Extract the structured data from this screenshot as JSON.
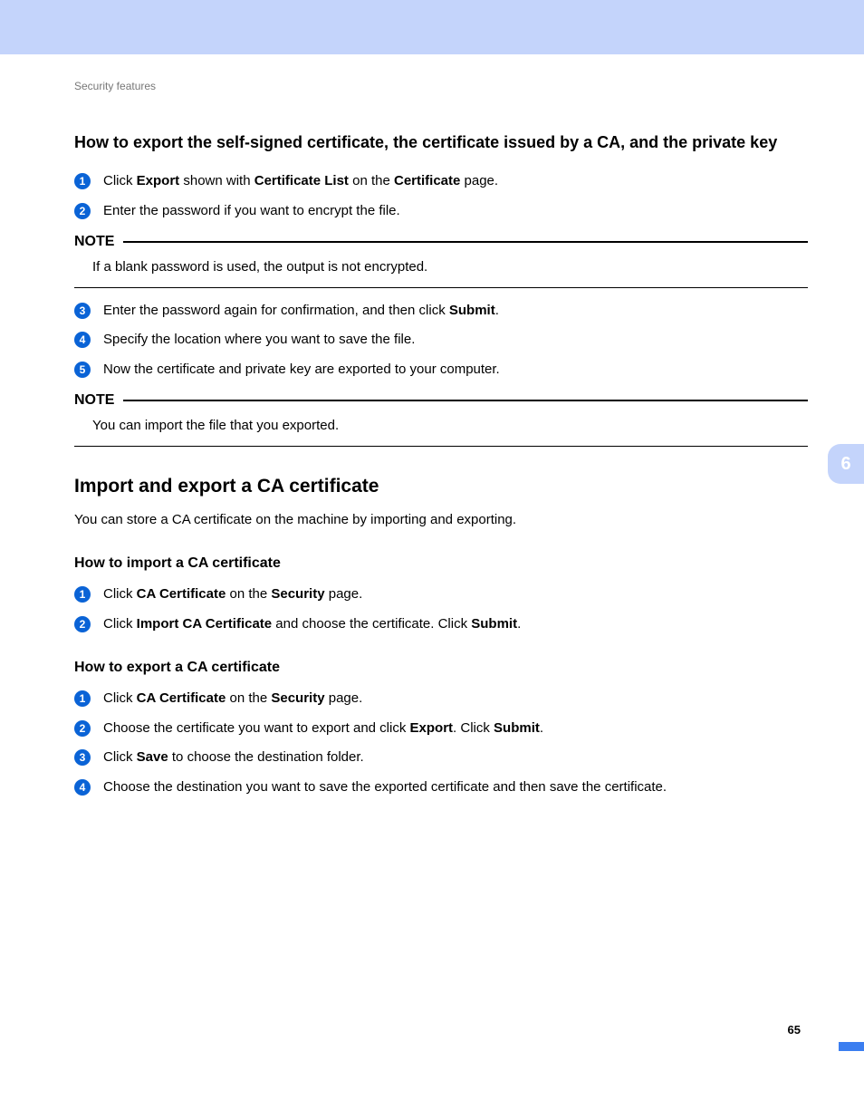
{
  "header": {
    "breadcrumb": "Security features"
  },
  "chapter_tab": "6",
  "page_number": "65",
  "sections": {
    "export_selfsigned": {
      "title": "How to export the self-signed certificate, the certificate issued by a CA, and the private key",
      "steps_a": [
        "Click <b>Export</b> shown with <b>Certificate List</b> on the <b>Certificate</b> page.",
        "Enter the password if you want to encrypt the file."
      ],
      "note_a": {
        "label": "NOTE",
        "body": "If a blank password is used, the output is not encrypted."
      },
      "steps_b": [
        "Enter the password again for confirmation, and then click <b>Submit</b>.",
        "Specify the location where you want to save the file.",
        "Now the certificate and private key are exported to your computer."
      ],
      "note_b": {
        "label": "NOTE",
        "body": "You can import the file that you exported."
      }
    },
    "ca_cert": {
      "title": "Import and export a CA certificate",
      "intro": "You can store a CA certificate on the machine by importing and exporting.",
      "import": {
        "title": "How to import a CA certificate",
        "steps": [
          "Click <b>CA Certificate</b> on the <b>Security</b> page.",
          "Click <b>Import CA Certificate</b> and choose the certificate. Click <b>Submit</b>."
        ]
      },
      "export": {
        "title": "How to export a CA certificate",
        "steps": [
          "Click <b>CA Certificate</b> on the <b>Security</b> page.",
          "Choose the certificate you want to export and click <b>Export</b>. Click <b>Submit</b>.",
          "Click <b>Save</b> to choose the destination folder.",
          "Choose the destination you want to save the exported certificate and then save the certificate."
        ]
      }
    }
  }
}
